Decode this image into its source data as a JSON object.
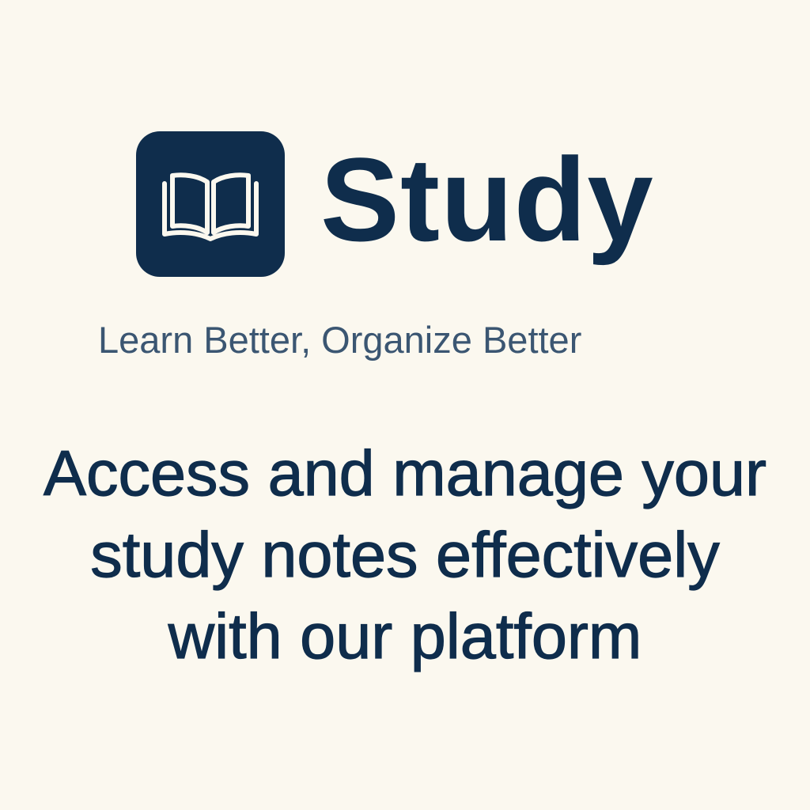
{
  "brand": {
    "logo_icon": "open-book-icon",
    "name": "Study"
  },
  "tagline": "Learn Better, Organize Better",
  "description": "Access and manage your study notes effectively with our platform",
  "colors": {
    "background": "#fbf8ef",
    "primary": "#0f2d4c",
    "tagline": "#3b5672"
  }
}
